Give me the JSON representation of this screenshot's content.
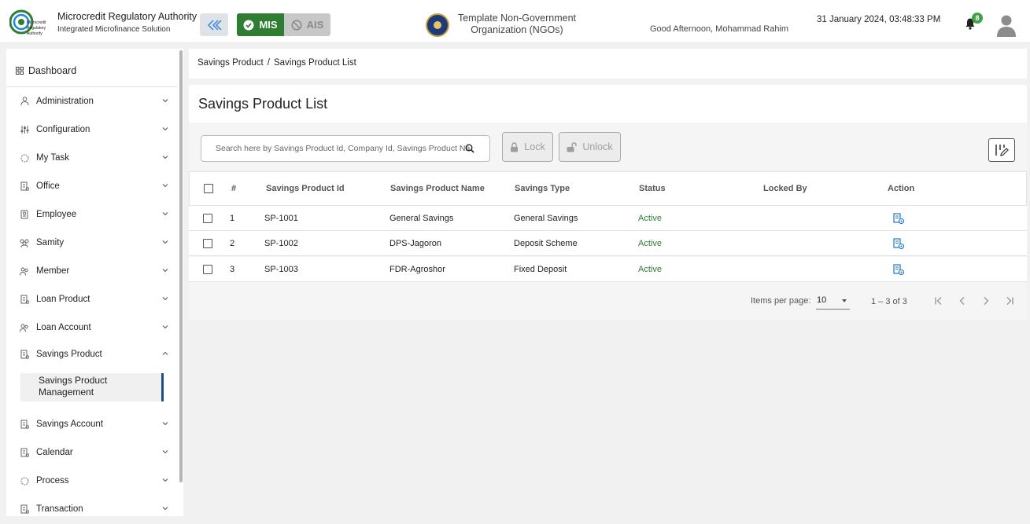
{
  "header": {
    "logo_text": "Microcredit Regulatory Authority",
    "org_title": "Microcredit Regulatory Authority",
    "org_subtitle": "Integrated Microfinance Solution",
    "mis_label": "MIS",
    "ais_label": "AIS",
    "ngo_name": "Template Non-Government Organization (NGOs)",
    "greeting": "Good Afternoon, Mohammad Rahim",
    "datetime": "31 January 2024, 03:48:33 PM",
    "notification_count": "8"
  },
  "sidebar": {
    "dashboard_label": "Dashboard",
    "items": [
      {
        "label": "Administration",
        "icon": "admin-icon"
      },
      {
        "label": "Configuration",
        "icon": "sliders-icon"
      },
      {
        "label": "My Task",
        "icon": "task-icon"
      },
      {
        "label": "Office",
        "icon": "office-icon"
      },
      {
        "label": "Employee",
        "icon": "employee-icon"
      },
      {
        "label": "Samity",
        "icon": "samity-icon"
      },
      {
        "label": "Member",
        "icon": "member-icon"
      },
      {
        "label": "Loan Product",
        "icon": "loan-product-icon"
      },
      {
        "label": "Loan Account",
        "icon": "loan-account-icon"
      },
      {
        "label": "Savings Product",
        "icon": "savings-product-icon"
      },
      {
        "label": "Savings Account",
        "icon": "savings-account-icon"
      },
      {
        "label": "Calendar",
        "icon": "calendar-icon"
      },
      {
        "label": "Process",
        "icon": "process-icon"
      },
      {
        "label": "Transaction",
        "icon": "transaction-icon"
      }
    ],
    "sub_item_label": "Savings Product Management"
  },
  "breadcrumb": {
    "parent": "Savings Product",
    "separator": "/",
    "current": "Savings Product List"
  },
  "page": {
    "title": "Savings Product List",
    "search_placeholder": "Search here by Savings Product Id, Company Id, Savings Product Name",
    "lock_label": "Lock",
    "unlock_label": "Unlock"
  },
  "table": {
    "headers": {
      "num": "#",
      "product_id": "Savings Product Id",
      "product_name": "Savings Product Name",
      "savings_type": "Savings Type",
      "status": "Status",
      "locked_by": "Locked By",
      "action": "Action"
    },
    "rows": [
      {
        "num": "1",
        "product_id": "SP-1001",
        "product_name": "General Savings",
        "savings_type": "General Savings",
        "status": "Active",
        "locked_by": ""
      },
      {
        "num": "2",
        "product_id": "SP-1002",
        "product_name": "DPS-Jagoron",
        "savings_type": "Deposit Scheme",
        "status": "Active",
        "locked_by": ""
      },
      {
        "num": "3",
        "product_id": "SP-1003",
        "product_name": "FDR-Agroshor",
        "savings_type": "Fixed Deposit",
        "status": "Active",
        "locked_by": ""
      }
    ]
  },
  "pagination": {
    "items_per_page_label": "Items per page:",
    "items_per_page": "10",
    "range": "1 – 3 of 3"
  },
  "colors": {
    "mis_green": "#2e7d32",
    "status_active": "#2e7d32",
    "active_nav_border": "#1c4e80",
    "action_icon": "#1976d2"
  }
}
